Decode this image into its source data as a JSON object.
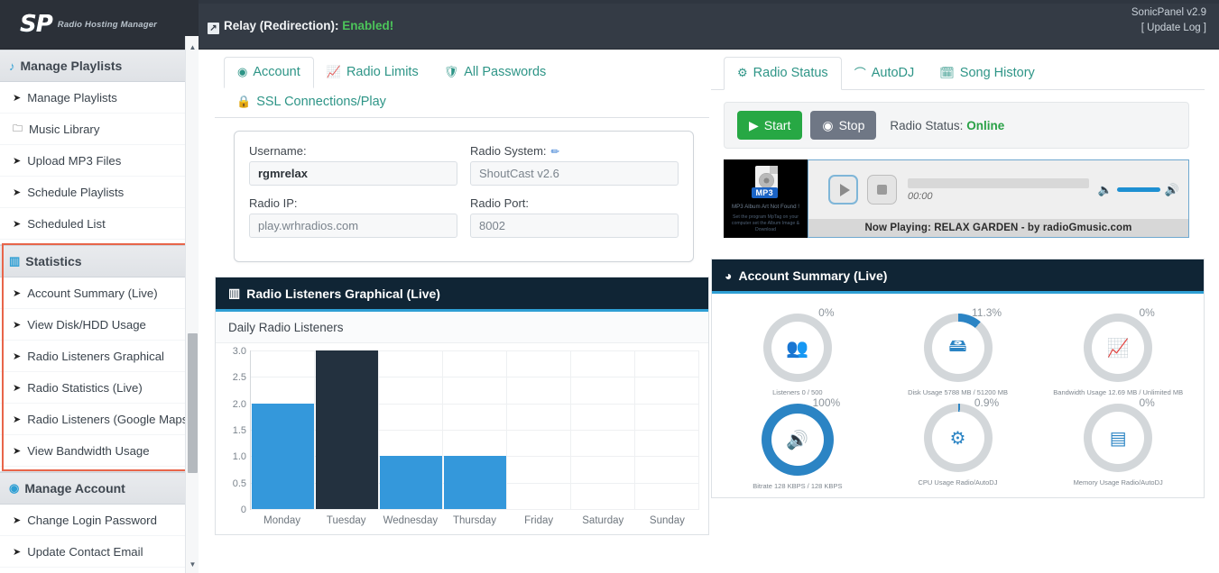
{
  "header": {
    "logo_text": "SP",
    "logo_tagline": "Radio Hosting Manager",
    "relay_label": "Relay (Redirection):",
    "relay_status": "Enabled!",
    "relay_icon": "external-link-icon",
    "version": "SonicPanel v2.9",
    "update_log": "[ Update Log ]"
  },
  "sidebar": {
    "groups": [
      {
        "title": "Manage Playlists",
        "icon": "music-note-icon",
        "items": [
          {
            "label": "Manage Playlists",
            "icon": "chevron-circle-icon"
          },
          {
            "label": "Music Library",
            "icon": "folder-icon"
          },
          {
            "label": "Upload MP3 Files",
            "icon": "chevron-circle-icon"
          },
          {
            "label": "Schedule Playlists",
            "icon": "chevron-circle-icon"
          },
          {
            "label": "Scheduled List",
            "icon": "chevron-circle-icon"
          }
        ]
      },
      {
        "title": "Statistics",
        "icon": "bar-chart-icon",
        "items": [
          {
            "label": "Account Summary (Live)",
            "icon": "chevron-circle-icon"
          },
          {
            "label": "View Disk/HDD Usage",
            "icon": "chevron-circle-icon"
          },
          {
            "label": "Radio Listeners Graphical",
            "icon": "chevron-circle-icon"
          },
          {
            "label": "Radio Statistics (Live)",
            "icon": "chevron-circle-icon"
          },
          {
            "label": "Radio Listeners (Google Maps)",
            "icon": "chevron-circle-icon"
          },
          {
            "label": "View Bandwidth Usage",
            "icon": "chevron-circle-icon"
          }
        ]
      },
      {
        "title": "Manage Account",
        "icon": "user-circle-icon",
        "items": [
          {
            "label": "Change Login Password",
            "icon": "chevron-circle-icon"
          },
          {
            "label": "Update Contact Email",
            "icon": "chevron-circle-icon"
          }
        ]
      }
    ],
    "highlight_color": "#e8654a"
  },
  "account_tabs": [
    {
      "label": "Account",
      "icon": "user-circle-icon",
      "active": true
    },
    {
      "label": "Radio Limits",
      "icon": "line-chart-icon",
      "active": false
    },
    {
      "label": "All Passwords",
      "icon": "shield-icon",
      "active": false
    },
    {
      "label": "SSL Connections/Play",
      "icon": "lock-icon",
      "active": false
    }
  ],
  "account_fields": [
    {
      "label": "Username:",
      "value": "rgmrelax",
      "strong": true,
      "edit": false
    },
    {
      "label": "Radio System:",
      "value": "ShoutCast v2.6",
      "strong": false,
      "edit": true
    },
    {
      "label": "Radio IP:",
      "value": "play.wrhradios.com",
      "strong": false,
      "edit": false
    },
    {
      "label": "Radio Port:",
      "value": "8002",
      "strong": false,
      "edit": false
    }
  ],
  "status_tabs": [
    {
      "label": "Radio Status",
      "icon": "gear-icon",
      "active": true
    },
    {
      "label": "AutoDJ",
      "icon": "headphones-icon",
      "active": false
    },
    {
      "label": "Song History",
      "icon": "calendar-icon",
      "active": false
    }
  ],
  "radio_control": {
    "start_label": "Start",
    "stop_label": "Stop",
    "status_label": "Radio Status:",
    "status_value": "Online",
    "status_color": "#2aa147"
  },
  "player": {
    "album_tag": "MP3",
    "album_line1": "MP3 Album Art Not Found !",
    "album_line2": "Set the program MpTag\non your computer\nset the Album Image & Download",
    "time": "00:00",
    "now_playing": "Now Playing: RELAX GARDEN - by radioGmusic.com",
    "play_icon": "play-icon",
    "stop_icon": "stop-icon",
    "volume_level": 80
  },
  "chart_panel": {
    "title": "Radio Listeners Graphical (Live)",
    "icon": "bar-chart-icon"
  },
  "summary_panel": {
    "title": "Account Summary (Live)",
    "icon": "pie-chart-icon"
  },
  "chart_data": {
    "type": "bar",
    "title": "Daily Radio Listeners",
    "xlabel": "",
    "ylabel": "",
    "categories": [
      "Monday",
      "Tuesday",
      "Wednesday",
      "Thursday",
      "Friday",
      "Saturday",
      "Sunday"
    ],
    "values": [
      2,
      3,
      1,
      1,
      0,
      0,
      0
    ],
    "highlight_index": 1,
    "bar_color": "#3498db",
    "highlight_color": "#23313f",
    "ylim": [
      0,
      3
    ],
    "yticks": [
      "3.0",
      "2.5",
      "2.0",
      "1.5",
      "1.0",
      "0.5",
      "0"
    ],
    "grid": true,
    "legend": "none"
  },
  "gauges": [
    {
      "percent": "0%",
      "value": 0,
      "icon": "people-icon",
      "label": "Listeners 0 / 500",
      "highlight": false
    },
    {
      "percent": "11.3%",
      "value": 11.3,
      "icon": "hdd-icon",
      "label": "Disk Usage 5788 MB / 51200 MB",
      "highlight": false
    },
    {
      "percent": "0%",
      "value": 0,
      "icon": "chart-line-icon",
      "label": "Bandwidth Usage 12.69 MB / Unlimited MB",
      "highlight": false
    },
    {
      "percent": "100%",
      "value": 100,
      "icon": "volume-icon",
      "label": "Bitrate 128 KBPS / 128 KBPS",
      "highlight": true
    },
    {
      "percent": "0.9%",
      "value": 0.9,
      "icon": "gear-icon",
      "label": "CPU Usage   Radio/AutoDJ",
      "highlight": false
    },
    {
      "percent": "0%",
      "value": 0,
      "icon": "server-icon",
      "label": "Memory Usage   Radio/AutoDJ",
      "highlight": false
    }
  ],
  "scrollbar": {
    "up_icon": "caret-up-icon",
    "down_icon": "caret-down-icon"
  }
}
